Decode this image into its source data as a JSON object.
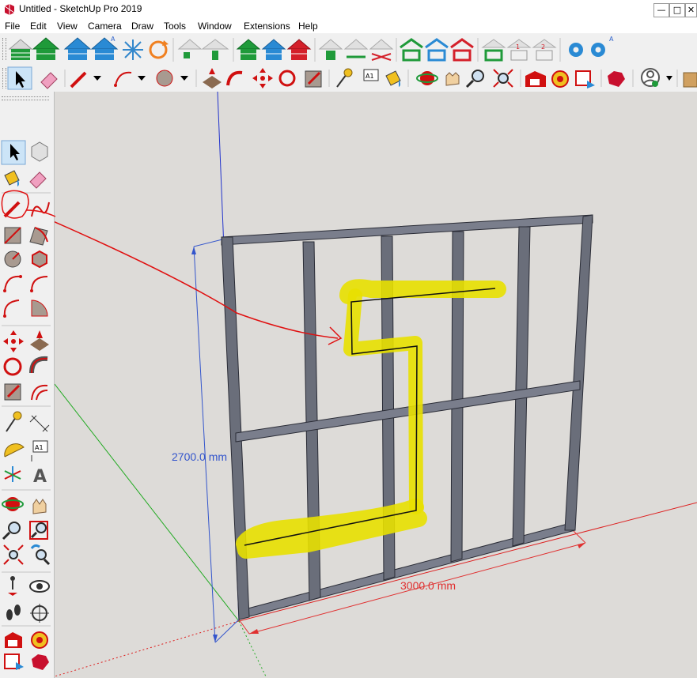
{
  "window": {
    "title": "Untitled - SketchUp Pro 2019",
    "controls": [
      "—",
      "□",
      "✕"
    ]
  },
  "menu": [
    "File",
    "Edit",
    "View",
    "Camera",
    "Draw",
    "Tools",
    "Window",
    "Extensions",
    "Help"
  ],
  "toolbar": {
    "text_tool_glyph": "A1",
    "extension_badge": "A"
  },
  "viewport": {
    "height_dimension": "2700.0 mm",
    "width_dimension": "3000.0 mm"
  },
  "left_toolbar": {
    "text_tool_glyph": "A1"
  },
  "colors": {
    "accent_red": "#e01010",
    "frame_steel": "#6a6e7a",
    "highlight_yellow": "#e8e000",
    "dimension_blue": "#3355cc",
    "dimension_red": "#e03030",
    "viewport_bg": "#dddbd8"
  }
}
